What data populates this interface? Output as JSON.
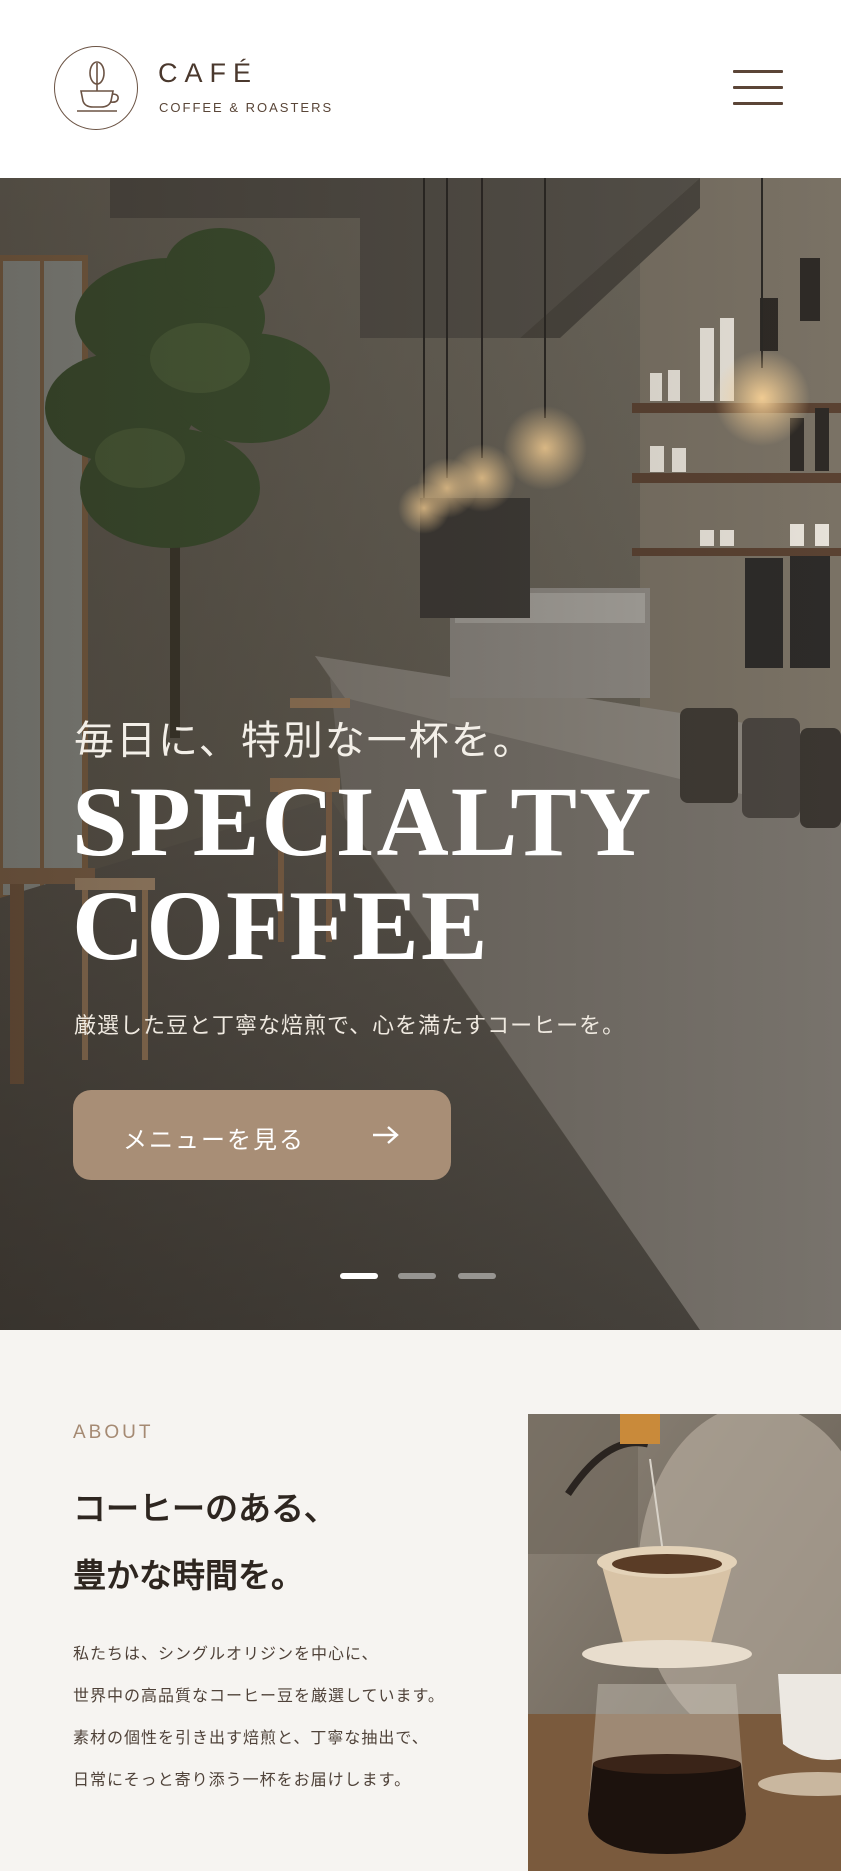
{
  "header": {
    "brand_name": "CAFÉ",
    "brand_sub": "COFFEE & ROASTERS",
    "logo_icon": "coffee-cup-bean-icon",
    "menu_icon": "hamburger-menu-icon"
  },
  "hero": {
    "kicker": "毎日に、特別な一杯を。",
    "title_line1": "SPECIALTY",
    "title_line2": "COFFEE",
    "subtitle": "厳選した豆と丁寧な焙煎で、心を満たすコーヒーを。",
    "cta_label": "メニューを見る",
    "cta_icon": "arrow-right-icon",
    "slides": [
      {
        "active": true
      },
      {
        "active": false
      },
      {
        "active": false
      }
    ]
  },
  "about": {
    "label": "ABOUT",
    "heading_line1": "コーヒーのある、",
    "heading_line2": "豊かな時間を。",
    "body_lines": [
      "私たちは、シングルオリジンを中心に、",
      "世界中の高品質なコーヒー豆を厳選しています。",
      "素材の個性を引き出す焙煎と、丁寧な抽出で、",
      "日常にそっと寄り添う一杯をお届けします。"
    ]
  },
  "colors": {
    "brand_brown": "#4a382d",
    "accent_tan": "#a88e76",
    "about_bg": "#f6f4f1",
    "label_tan": "#a58a73"
  }
}
